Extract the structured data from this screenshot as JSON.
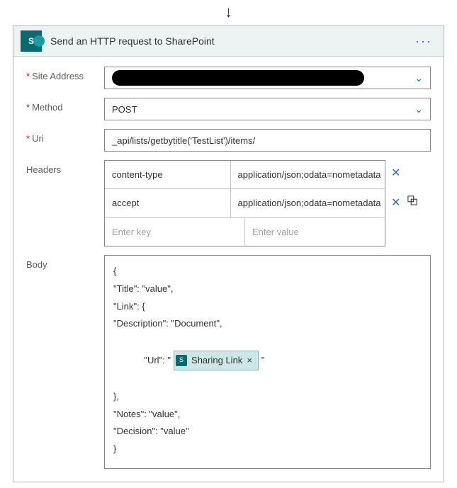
{
  "header": {
    "title": "Send an HTTP request to SharePoint"
  },
  "fields": {
    "site_address": {
      "label": "Site Address",
      "value": "[redacted]"
    },
    "method": {
      "label": "Method",
      "value": "POST"
    },
    "uri": {
      "label": "Uri",
      "value": "_api/lists/getbytitle('TestList')/items/"
    },
    "headers": {
      "label": "Headers",
      "rows": [
        {
          "key": "content-type",
          "value": "application/json;odata=nometadata"
        },
        {
          "key": "accept",
          "value": "application/json;odata=nometadata"
        }
      ],
      "placeholder_key": "Enter key",
      "placeholder_value": "Enter value"
    },
    "body": {
      "label": "Body",
      "lines": [
        "{",
        "\"Title\": \"value\",",
        "\"Link\": {",
        "\"Description\": \"Document\",",
        "\"Url\": \"",
        "\"",
        "},",
        "\"Notes\": \"value\",",
        "\"Decision\": \"value\"",
        "}"
      ],
      "token": {
        "label": "Sharing Link"
      }
    }
  }
}
